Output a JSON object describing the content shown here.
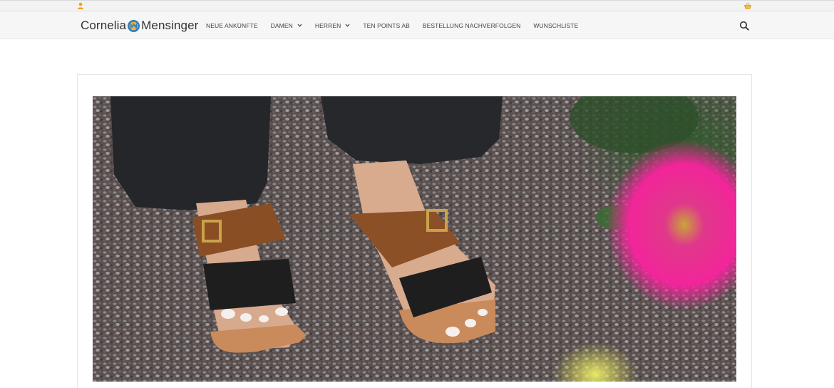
{
  "brand": {
    "name_left": "Cornelia",
    "name_right": "Mensinger"
  },
  "topbar": {
    "user_icon": "user-icon",
    "cart_icon": "basket-icon",
    "accent_color": "#e8a317"
  },
  "nav": {
    "items": [
      {
        "label": "NEUE ANKÜNFTE",
        "has_dropdown": false
      },
      {
        "label": "DAMEN",
        "has_dropdown": true
      },
      {
        "label": "HERREN",
        "has_dropdown": true
      },
      {
        "label": "TEN POINTS AB",
        "has_dropdown": false
      },
      {
        "label": "BESTELLUNG NACHVERFOLGEN",
        "has_dropdown": false
      },
      {
        "label": "WUNSCHLISTE",
        "has_dropdown": false
      }
    ],
    "search_icon": "search-icon"
  },
  "hero": {
    "image": "product-photo-sandals"
  }
}
